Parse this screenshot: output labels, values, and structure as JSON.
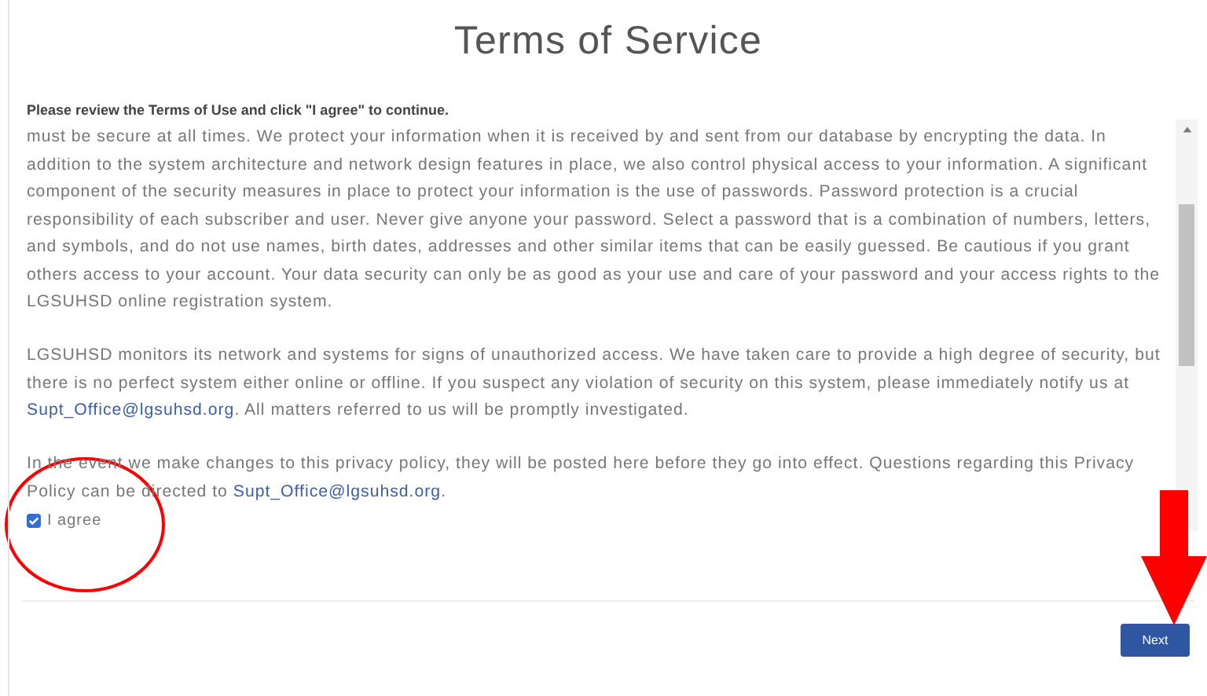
{
  "title": "Terms of Service",
  "instruction": "Please review the Terms of Use and click \"I agree\" to continue.",
  "paragraphs": [
    {
      "text": "must be secure at all times. We protect your information when it is received by and sent from our database by encrypting the data. In addition to the system architecture and network design features in place, we also control physical access to your information. A significant component of the security measures in place to protect your information is the use of passwords. Password protection is a crucial responsibility of each subscriber and user. Never give anyone your password. Select a password that is a combination of numbers, letters, and symbols, and do not use names, birth dates, addresses and other similar items that can be easily guessed. Be cautious if you grant others access to your account. Your data security can only be as good as your use and care of your password and your access rights to the LGSUHSD online registration system."
    },
    {
      "text": "LGSUHSD monitors its network and systems for signs of unauthorized access. We have taken care to provide a high degree of security, but there is no perfect system either online or offline. If you suspect any violation of security on this system, please immediately notify us at ",
      "link": "Supt_Office@lgsuhsd.org",
      "after": ". All matters referred to us will be promptly investigated."
    },
    {
      "text": "In the event we make changes to this privacy policy, they will be posted here before they go into effect. Questions regarding this Privacy Policy can be directed to ",
      "link": "Supt_Office@lgsuhsd.org",
      "after": "."
    }
  ],
  "agree": {
    "label": "I agree",
    "checked": true
  },
  "next_button": "Next"
}
